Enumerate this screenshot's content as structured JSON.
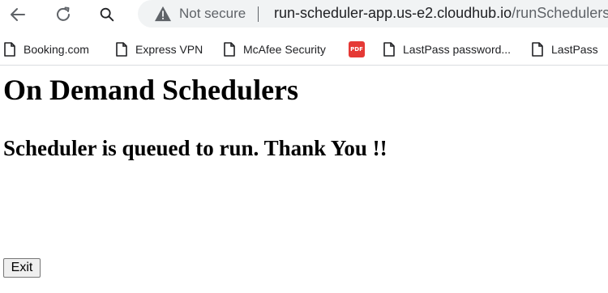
{
  "browser": {
    "nav": {
      "back_icon": "back-arrow-icon",
      "reload_icon": "reload-icon",
      "search_icon": "search-icon"
    },
    "omnibox": {
      "security_icon": "warning-triangle-icon",
      "security_label": "Not secure",
      "host": "run-scheduler-app.us-e2.cloudhub.io",
      "path": "/runSchedulers"
    },
    "bookmarks": [
      {
        "label": "Booking.com",
        "icon": "page-icon"
      },
      {
        "label": "Express VPN",
        "icon": "page-icon"
      },
      {
        "label": "McAfee Security",
        "icon": "page-icon"
      },
      {
        "label": "PDF",
        "icon": "pdf-icon"
      },
      {
        "label": "LastPass password...",
        "icon": "page-icon"
      },
      {
        "label": "LastPass",
        "icon": "page-icon"
      }
    ]
  },
  "page": {
    "title": "On Demand Schedulers",
    "message": "Scheduler is queued to run. Thank You !!",
    "exit_label": "Exit"
  },
  "colors": {
    "omnibox_bg": "#f1f3f4",
    "secondary_text": "#5f6368",
    "pdf_red": "#e53935"
  }
}
